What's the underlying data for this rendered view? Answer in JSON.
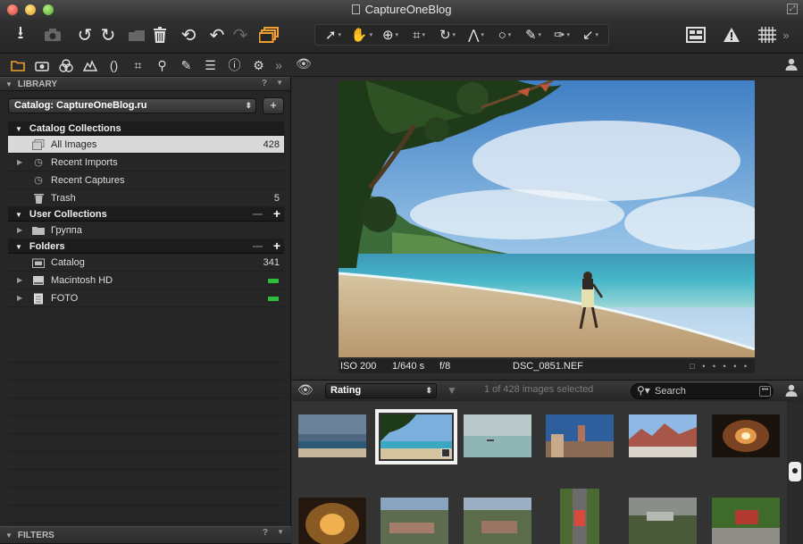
{
  "window": {
    "title": "CaptureOneBlog"
  },
  "toolbar": {
    "left_icons": [
      "import-icon",
      "camera-icon",
      "rotate-left-icon",
      "rotate-right-icon",
      "make-selects-folder-icon",
      "trash-icon",
      "undo-icon",
      "back-icon",
      "forward-icon",
      "variants-icon"
    ],
    "cursor_tools": [
      "pointer-tool",
      "pan-tool",
      "zoom-tool",
      "crop-tool",
      "rotate-tool",
      "keystone-tool",
      "spot-removal-tool",
      "brush-tool",
      "color-picker-tool",
      "apply-adjustments-tool"
    ],
    "right_icons": [
      "viewer-layout-icon",
      "exposure-warning-icon",
      "grid-icon"
    ]
  },
  "tool_tabs": [
    "library-tab",
    "capture-tab",
    "color-tab",
    "exposure-tab",
    "lens-tab",
    "composition-tab",
    "details-tab",
    "local-adjustments-tab",
    "metadata-tab",
    "output-tab",
    "settings-tab"
  ],
  "library": {
    "header": "LIBRARY",
    "help": "?",
    "catalog_name": "Catalog: CaptureOneBlog.ru",
    "catalog_collections": {
      "title": "Catalog Collections",
      "items": [
        {
          "label": "All Images",
          "count": "428"
        },
        {
          "label": "Recent Imports",
          "count": ""
        },
        {
          "label": "Recent Captures",
          "count": ""
        },
        {
          "label": "Trash",
          "count": "5"
        }
      ]
    },
    "user_collections": {
      "title": "User Collections",
      "items": [
        {
          "label": "Группа"
        }
      ]
    },
    "folders": {
      "title": "Folders",
      "items": [
        {
          "label": "Catalog",
          "count": "341"
        },
        {
          "label": "Macintosh HD",
          "count": ""
        },
        {
          "label": "FOTO",
          "count": ""
        }
      ]
    }
  },
  "filters": {
    "header": "FILTERS",
    "help": "?"
  },
  "viewer": {
    "iso": "ISO 200",
    "shutter": "1/640 s",
    "aperture": "f/8",
    "filename": "DSC_0851.NEF",
    "stars": "□ • • • • •"
  },
  "browser": {
    "sort_by": "Rating",
    "selection_status": "1 of 428 images selected",
    "search_placeholder": "Search"
  },
  "colors": {
    "accent": "#f0a030",
    "selection": "#d9d9d9",
    "drive_indicator": "#2fbf3a"
  }
}
